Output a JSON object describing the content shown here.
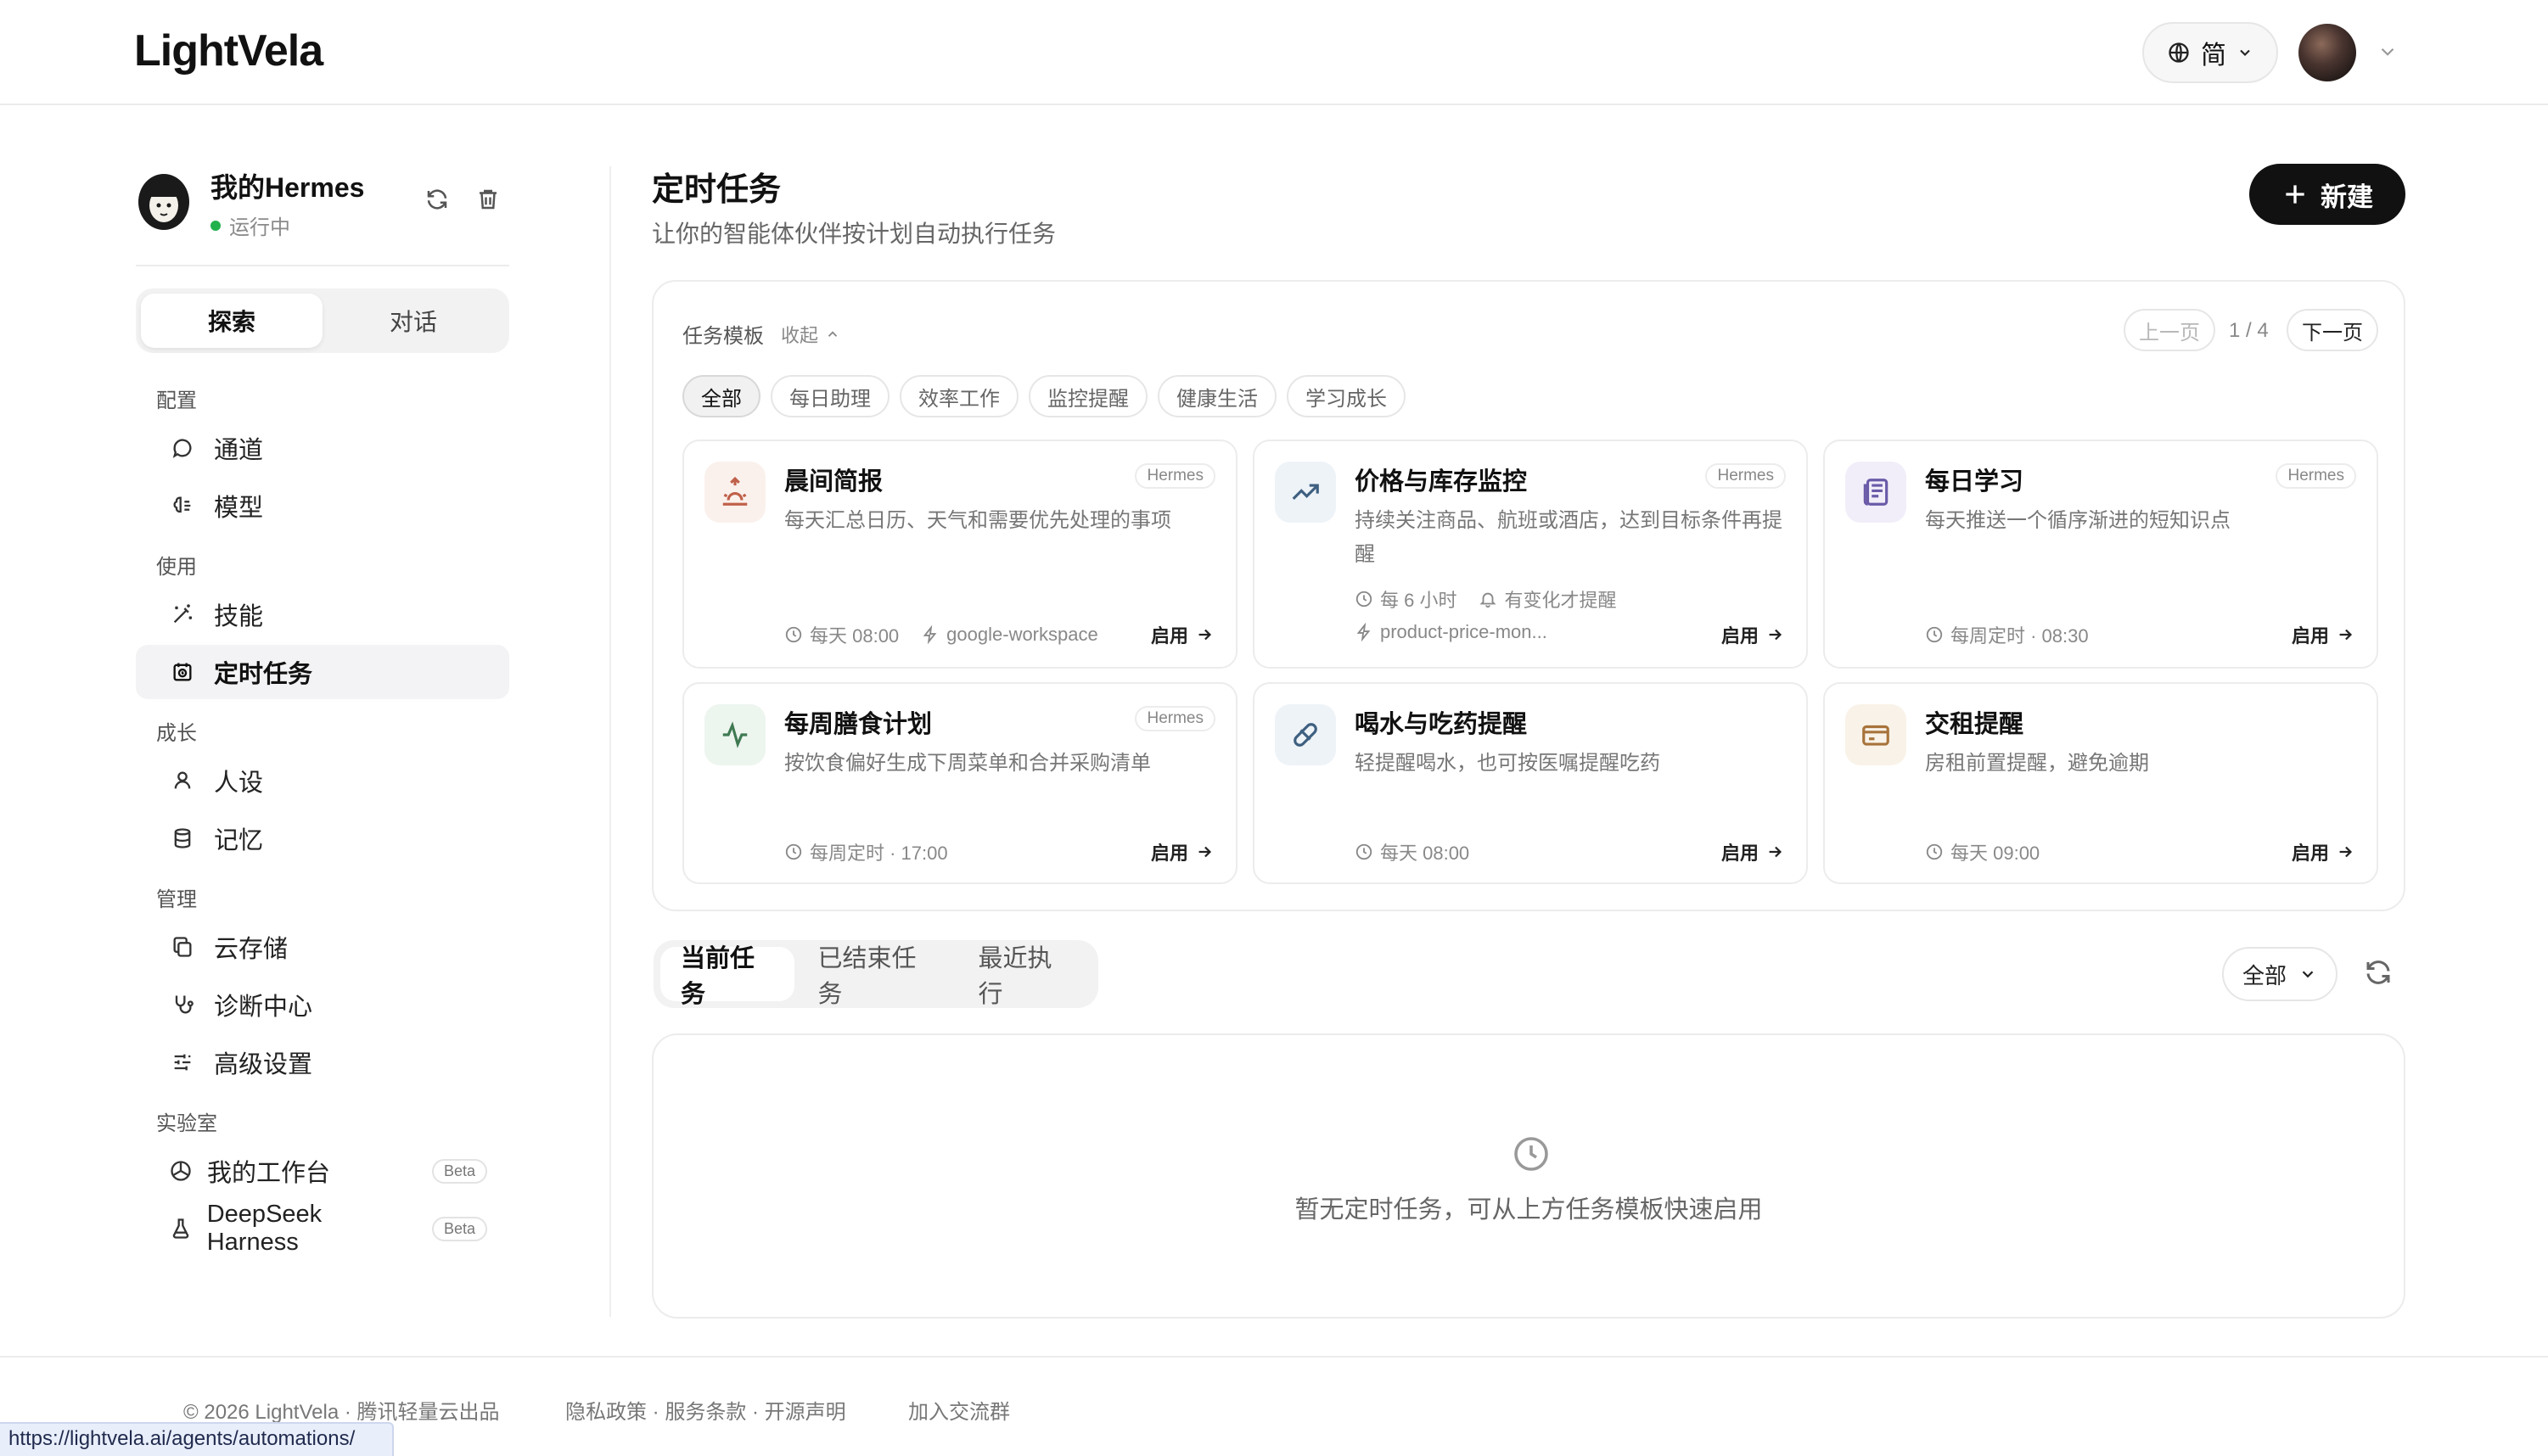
{
  "app": {
    "logo": "LightVela",
    "lang_label": "简"
  },
  "profile": {
    "name": "我的Hermes",
    "status": "运行中"
  },
  "sidebar": {
    "segments": [
      "探索",
      "对话"
    ],
    "groups": {
      "config": "配置",
      "use": "使用",
      "growth": "成长",
      "manage": "管理",
      "lab": "实验室"
    },
    "items": {
      "channel": "通道",
      "model": "模型",
      "skills": "技能",
      "scheduled": "定时任务",
      "persona": "人设",
      "memory": "记忆",
      "storage": "云存储",
      "diagnostics": "诊断中心",
      "advanced": "高级设置",
      "workbench": "我的工作台",
      "deepseek": "DeepSeek Harness"
    },
    "beta_label": "Beta"
  },
  "main": {
    "title": "定时任务",
    "subtitle": "让你的智能体伙伴按计划自动执行任务",
    "new_button": "新建"
  },
  "templates": {
    "label": "任务模板",
    "collapse": "收起",
    "prev": "上一页",
    "page": "1 / 4",
    "next": "下一页",
    "chips": [
      "全部",
      "每日助理",
      "效率工作",
      "监控提醒",
      "健康生活",
      "学习成长"
    ],
    "enable_label": "启用",
    "cards": [
      {
        "title": "晨间简报",
        "desc": "每天汇总日历、天气和需要优先处理的事项",
        "tag": "Hermes",
        "schedule": "每天 08:00",
        "skill": "google-workspace",
        "icon": "sunrise-icon",
        "icon_bg": "#fbf1ec",
        "icon_color": "#c0604a"
      },
      {
        "title": "价格与库存监控",
        "desc": "持续关注商品、航班或酒店，达到目标条件再提醒",
        "tag": "Hermes",
        "schedule": "每 6 小时",
        "notify": "有变化才提醒",
        "skill": "product-price-mon...",
        "icon": "trend-up-icon",
        "icon_bg": "#eef3f8",
        "icon_color": "#3e5f80"
      },
      {
        "title": "每日学习",
        "desc": "每天推送一个循序渐进的短知识点",
        "tag": "Hermes",
        "schedule": "每周定时 · 08:30",
        "icon": "newspaper-icon",
        "icon_bg": "#f1eef9",
        "icon_color": "#6a5aa8"
      },
      {
        "title": "每周膳食计划",
        "desc": "按饮食偏好生成下周菜单和合并采购清单",
        "tag": "Hermes",
        "schedule": "每周定时 · 17:00",
        "icon": "pulse-icon",
        "icon_bg": "#edf5ef",
        "icon_color": "#3f7a52"
      },
      {
        "title": "喝水与吃药提醒",
        "desc": "轻提醒喝水，也可按医嘱提醒吃药",
        "schedule": "每天 08:00",
        "icon": "pill-icon",
        "icon_bg": "#eef3f8",
        "icon_color": "#3e5f80"
      },
      {
        "title": "交租提醒",
        "desc": "房租前置提醒，避免逾期",
        "schedule": "每天 09:00",
        "icon": "card-icon",
        "icon_bg": "#f9f2e8",
        "icon_color": "#a7733a"
      }
    ]
  },
  "tasks": {
    "tabs": [
      "当前任务",
      "已结束任务",
      "最近执行"
    ],
    "filter": "全部",
    "empty_text": "暂无定时任务，可从上方任务模板快速启用"
  },
  "footer": {
    "copyright": "© 2026 LightVela · 腾讯轻量云出品",
    "links": "隐私政策 · 服务条款 · 开源声明",
    "community": "加入交流群"
  },
  "status_url": "https://lightvela.ai/agents/automations/"
}
